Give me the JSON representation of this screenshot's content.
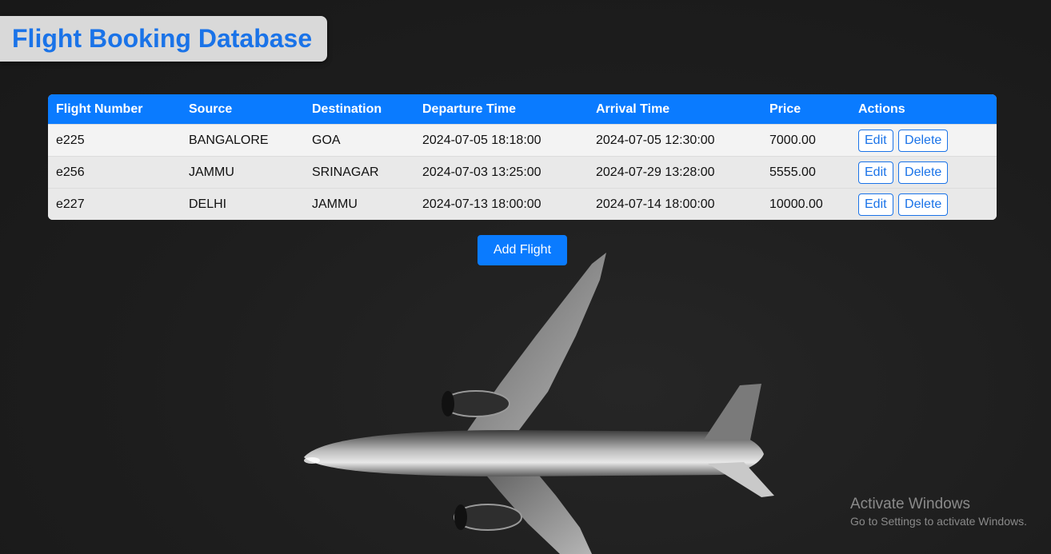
{
  "page": {
    "title": "Flight Booking Database"
  },
  "table": {
    "headers": [
      "Flight Number",
      "Source",
      "Destination",
      "Departure Time",
      "Arrival Time",
      "Price",
      "Actions"
    ],
    "rows": [
      {
        "flight_number": "e225",
        "source": "BANGALORE",
        "destination": "GOA",
        "departure": "2024-07-05 18:18:00",
        "arrival": "2024-07-05 12:30:00",
        "price": "7000.00"
      },
      {
        "flight_number": "e256",
        "source": "JAMMU",
        "destination": "SRINAGAR",
        "departure": "2024-07-03 13:25:00",
        "arrival": "2024-07-29 13:28:00",
        "price": "5555.00"
      },
      {
        "flight_number": "e227",
        "source": "DELHI",
        "destination": "JAMMU",
        "departure": "2024-07-13 18:00:00",
        "arrival": "2024-07-14 18:00:00",
        "price": "10000.00"
      }
    ],
    "edit_label": "Edit",
    "delete_label": "Delete"
  },
  "add_button_label": "Add Flight",
  "watermark": {
    "line1": "Activate Windows",
    "line2": "Go to Settings to activate Windows."
  },
  "colors": {
    "accent": "#0a7bff",
    "title_text": "#1a73e8",
    "background": "#1d1d1d"
  },
  "background_image": "airplane-silhouette"
}
